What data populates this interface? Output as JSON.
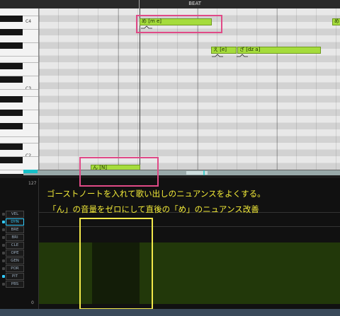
{
  "ruler": {
    "beat_label": "BEAT"
  },
  "piano": {
    "octave_labels": [
      "C4",
      "C3",
      "C2"
    ]
  },
  "notes": [
    {
      "lyric": "め [m e]"
    },
    {
      "lyric": "え [e]"
    },
    {
      "lyric": "ざ [dz a]"
    },
    {
      "lyric": "ん [N]"
    },
    {
      "lyric": "め"
    }
  ],
  "parameter_panel": {
    "scale_max": "127",
    "scale_min": "0",
    "items": [
      "VEL",
      "DYN",
      "BRE",
      "BRI",
      "CLE",
      "OPE",
      "GEN",
      "POR",
      "PIT",
      "PBS"
    ],
    "selected": "DYN"
  },
  "annotations": {
    "line1": "ゴーストノートを入れて歌い出しのニュアンスをよくする。",
    "line2": "「ん」の音量をゼロにして直後の「め」のニュアンス改善"
  },
  "colors": {
    "note_fill": "#a5dc3c",
    "dynamics_fill": "#22380a",
    "highlight_pink": "#e04a87",
    "highlight_yellow": "#f2e84a",
    "caption_text": "#f4ec38",
    "selected_param": "#33ccff"
  }
}
